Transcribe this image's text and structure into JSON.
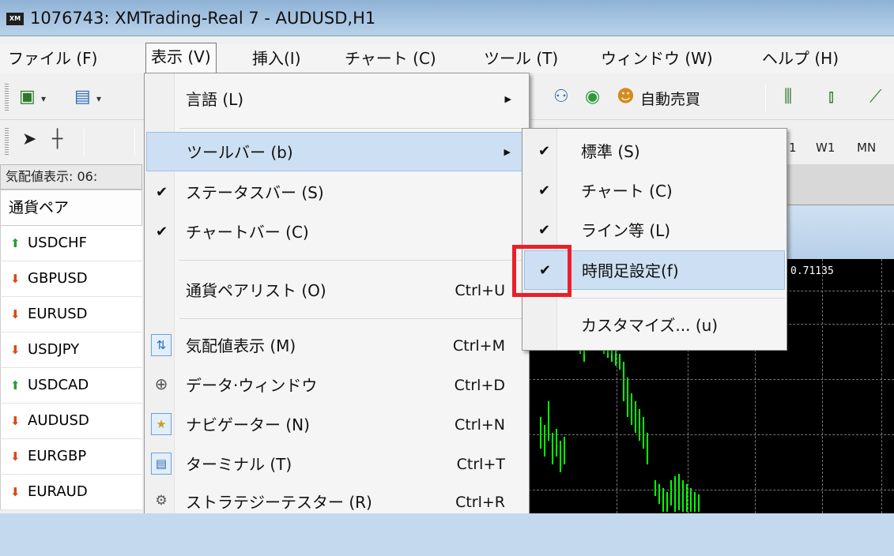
{
  "window": {
    "logo_text": "XM",
    "title": "1076743: XMTrading-Real 7 - AUDUSD,H1"
  },
  "menubar": [
    {
      "label": "ファイル (F)"
    },
    {
      "label": "表示 (V)"
    },
    {
      "label": "挿入(I)"
    },
    {
      "label": "チャート (C)"
    },
    {
      "label": "ツール (T)"
    },
    {
      "label": "ウィンドウ (W)"
    },
    {
      "label": "ヘルプ (H)"
    }
  ],
  "toolbar": {
    "auto_trade_label": "自動売買",
    "periods": [
      "1",
      "W1",
      "MN"
    ]
  },
  "market_watch": {
    "header": "気配値表示: 06:",
    "column": "通貨ペア",
    "rows": [
      {
        "symbol": "USDCHF",
        "trend": "up"
      },
      {
        "symbol": "GBPUSD",
        "trend": "down"
      },
      {
        "symbol": "EURUSD",
        "trend": "down"
      },
      {
        "symbol": "USDJPY",
        "trend": "down"
      },
      {
        "symbol": "USDCAD",
        "trend": "up"
      },
      {
        "symbol": "AUDUSD",
        "trend": "down"
      },
      {
        "symbol": "EURGBP",
        "trend": "down"
      },
      {
        "symbol": "EURAUD",
        "trend": "down"
      }
    ]
  },
  "chart": {
    "price_label": "0.71135",
    "candle_color": "#00ff00"
  },
  "view_menu": {
    "items": [
      {
        "label": "言語 (L)",
        "submenu": true
      },
      {
        "label": "ツールバー (b)",
        "submenu": true,
        "highlighted": true
      },
      {
        "label": "ステータスバー (S)",
        "checked": true
      },
      {
        "label": "チャートバー (C)",
        "checked": true
      },
      {
        "label": "通貨ペアリスト (O)",
        "shortcut": "Ctrl+U"
      },
      {
        "label": "気配値表示 (M)",
        "shortcut": "Ctrl+M",
        "icon": "market-watch-icon"
      },
      {
        "label": "データ·ウィンドウ",
        "shortcut": "Ctrl+D",
        "icon": "crosshair-icon"
      },
      {
        "label": "ナビゲーター (N)",
        "shortcut": "Ctrl+N",
        "icon": "navigator-icon"
      },
      {
        "label": "ターミナル (T)",
        "shortcut": "Ctrl+T",
        "icon": "terminal-icon"
      },
      {
        "label": "ストラテジーテスター (R)",
        "shortcut": "Ctrl+R",
        "icon": "tester-icon"
      }
    ]
  },
  "toolbar_submenu": {
    "items": [
      {
        "label": "標準 (S)",
        "checked": true
      },
      {
        "label": "チャート (C)",
        "checked": true
      },
      {
        "label": "ライン等 (L)",
        "checked": true
      },
      {
        "label": "時間足設定(f)",
        "checked": true,
        "highlighted": true
      },
      {
        "label": "カスタマイズ... (u)"
      }
    ]
  },
  "symbols": {
    "check": "✔",
    "submenu_arrow": "▶",
    "arrow_up": "⬆",
    "arrow_down": "⬇"
  },
  "colors": {
    "highlight": "#cde0f3",
    "annotation_box": "#e8202a"
  }
}
